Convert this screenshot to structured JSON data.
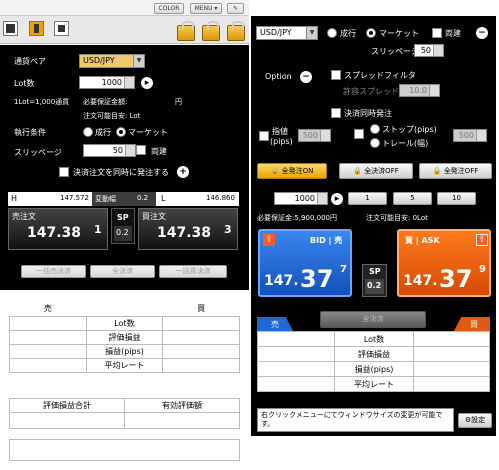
{
  "top": {
    "color_label": "COLOR",
    "menu_label": "MENU ▾",
    "pin_icon": "pin-icon"
  },
  "left": {
    "pair_label": "通貨ペア",
    "pair_value": "USD/JPY",
    "lot_label": "Lot数",
    "lot_value": "1000",
    "lot_note": "1Lot=1,000通貨",
    "margin_label": "必要保証金額:",
    "margin_unit": "円",
    "order_est_label": "注文可能目安: Lot",
    "exec_label": "執行条件",
    "exec_opt1": "成行",
    "exec_opt2": "マーケット",
    "slip_label": "スリッページ",
    "slip_value": "50",
    "both_label": "両建",
    "settle_label": "決済注文を同時に発注する",
    "high_label": "H",
    "high_value": "147.572",
    "range_label": "変動幅",
    "range_value": "0.2",
    "low_label": "L",
    "low_value": "146.860",
    "sell_label": "売注文",
    "sell_main": "147.38",
    "sell_last": "1",
    "sp_label": "SP",
    "sp_value": "0.2",
    "buy_label": "買注文",
    "buy_main": "147.38",
    "buy_last": "3",
    "btn_sell_settle": "一括売決済",
    "btn_all_settle": "全決済",
    "btn_buy_settle": "一括買決済",
    "table_sell": "売",
    "table_buy": "買",
    "rows": [
      "Lot数",
      "評価損益",
      "損益(pips)",
      "平均レート"
    ],
    "eval_total": "評価損益合計",
    "valid_eval": "有効評価額"
  },
  "right": {
    "pair_value": "USD/JPY",
    "exec_opt1": "成行",
    "exec_opt2": "マーケット",
    "both_label": "両建",
    "slip_label": "スリッページ",
    "slip_value": "50",
    "option_label": "Option",
    "spread_filter": "スプレッドフィルタ",
    "allow_spread": "許容スプレッド",
    "allow_value": "10.0",
    "settle_same": "決済同時発注",
    "limit_label": "指値",
    "limit_sub": "(pips)",
    "limit_value": "500",
    "stop_label": "ストップ(pips)",
    "trail_label": "トレール(幅)",
    "stop_value": "500",
    "all_on": "全発注ON",
    "all_settle_off": "全決済OFF",
    "all_off": "全発注OFF",
    "lot_value": "1000",
    "lot_b1": "1",
    "lot_b2": "5",
    "lot_b3": "10",
    "margin_text": "必要保証金:5,900,000円",
    "order_est": "注文可能目安: 0Lot",
    "bid_label": "BID | 売",
    "bid_main": "147.37",
    "bid_last": "7",
    "sp_label": "SP",
    "sp_value": "0.2",
    "ask_label": "買 | ASK",
    "ask_main": "147.37",
    "ask_last": "9",
    "tab_sell": "売",
    "tab_buy": "買",
    "all_settle": "全決済",
    "rows": [
      "Lot数",
      "評価損益",
      "損益(pips)",
      "平均レート"
    ],
    "status": "右クリックメニューにてウィンドウサイズの変更が可能です。",
    "settings_label": "設定"
  },
  "colors": {
    "bid": "#1f66d6",
    "ask": "#e25a12",
    "panel": "#000000"
  }
}
